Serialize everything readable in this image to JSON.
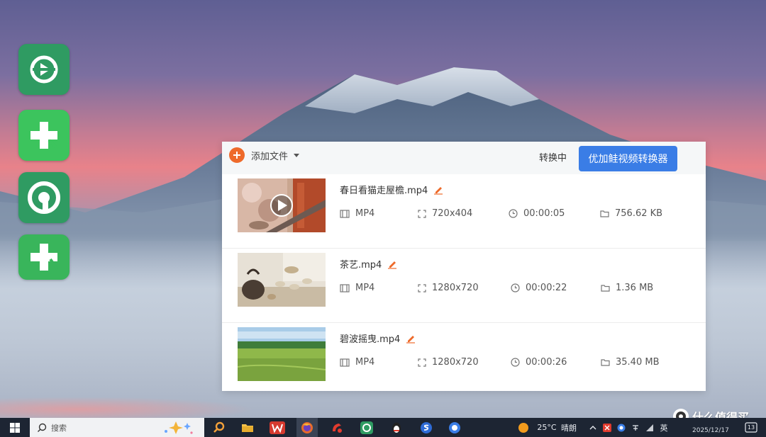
{
  "desktop": {
    "icons": [
      {
        "name": "video-converter-app-icon",
        "color": "#2f9b62"
      },
      {
        "name": "medical-app-icon-1",
        "color": "#3cc45d"
      },
      {
        "name": "q-app-icon",
        "color": "#2f9b62"
      },
      {
        "name": "medical-app-icon-2",
        "color": "#39b55b"
      }
    ]
  },
  "app": {
    "toolbar": {
      "add_file_label": "添加文件",
      "status_label": "转换中",
      "brand_button_label": "优加鲑视频转换器"
    },
    "accent_color": "#3a7de6",
    "add_color": "#ee6a2a",
    "files": [
      {
        "name": "春日看猫走屋檐.mp4",
        "format": "MP4",
        "resolution": "720x404",
        "duration": "00:00:05",
        "size": "756.62 KB",
        "thumb": "cat-blossom"
      },
      {
        "name": "茶艺.mp4",
        "format": "MP4",
        "resolution": "1280x720",
        "duration": "00:00:22",
        "size": "1.36 MB",
        "thumb": "tea-set"
      },
      {
        "name": "碧波摇曳.mp4",
        "format": "MP4",
        "resolution": "1280x720",
        "duration": "00:00:26",
        "size": "35.40 MB",
        "thumb": "grass-field"
      }
    ]
  },
  "taskbar": {
    "search_placeholder": "搜索",
    "weather": "25°C",
    "weather_desc": "晴朗",
    "ime": "英",
    "date": "2025/12/17",
    "notification_count": "13"
  },
  "watermark": {
    "text": "什么值得买"
  }
}
